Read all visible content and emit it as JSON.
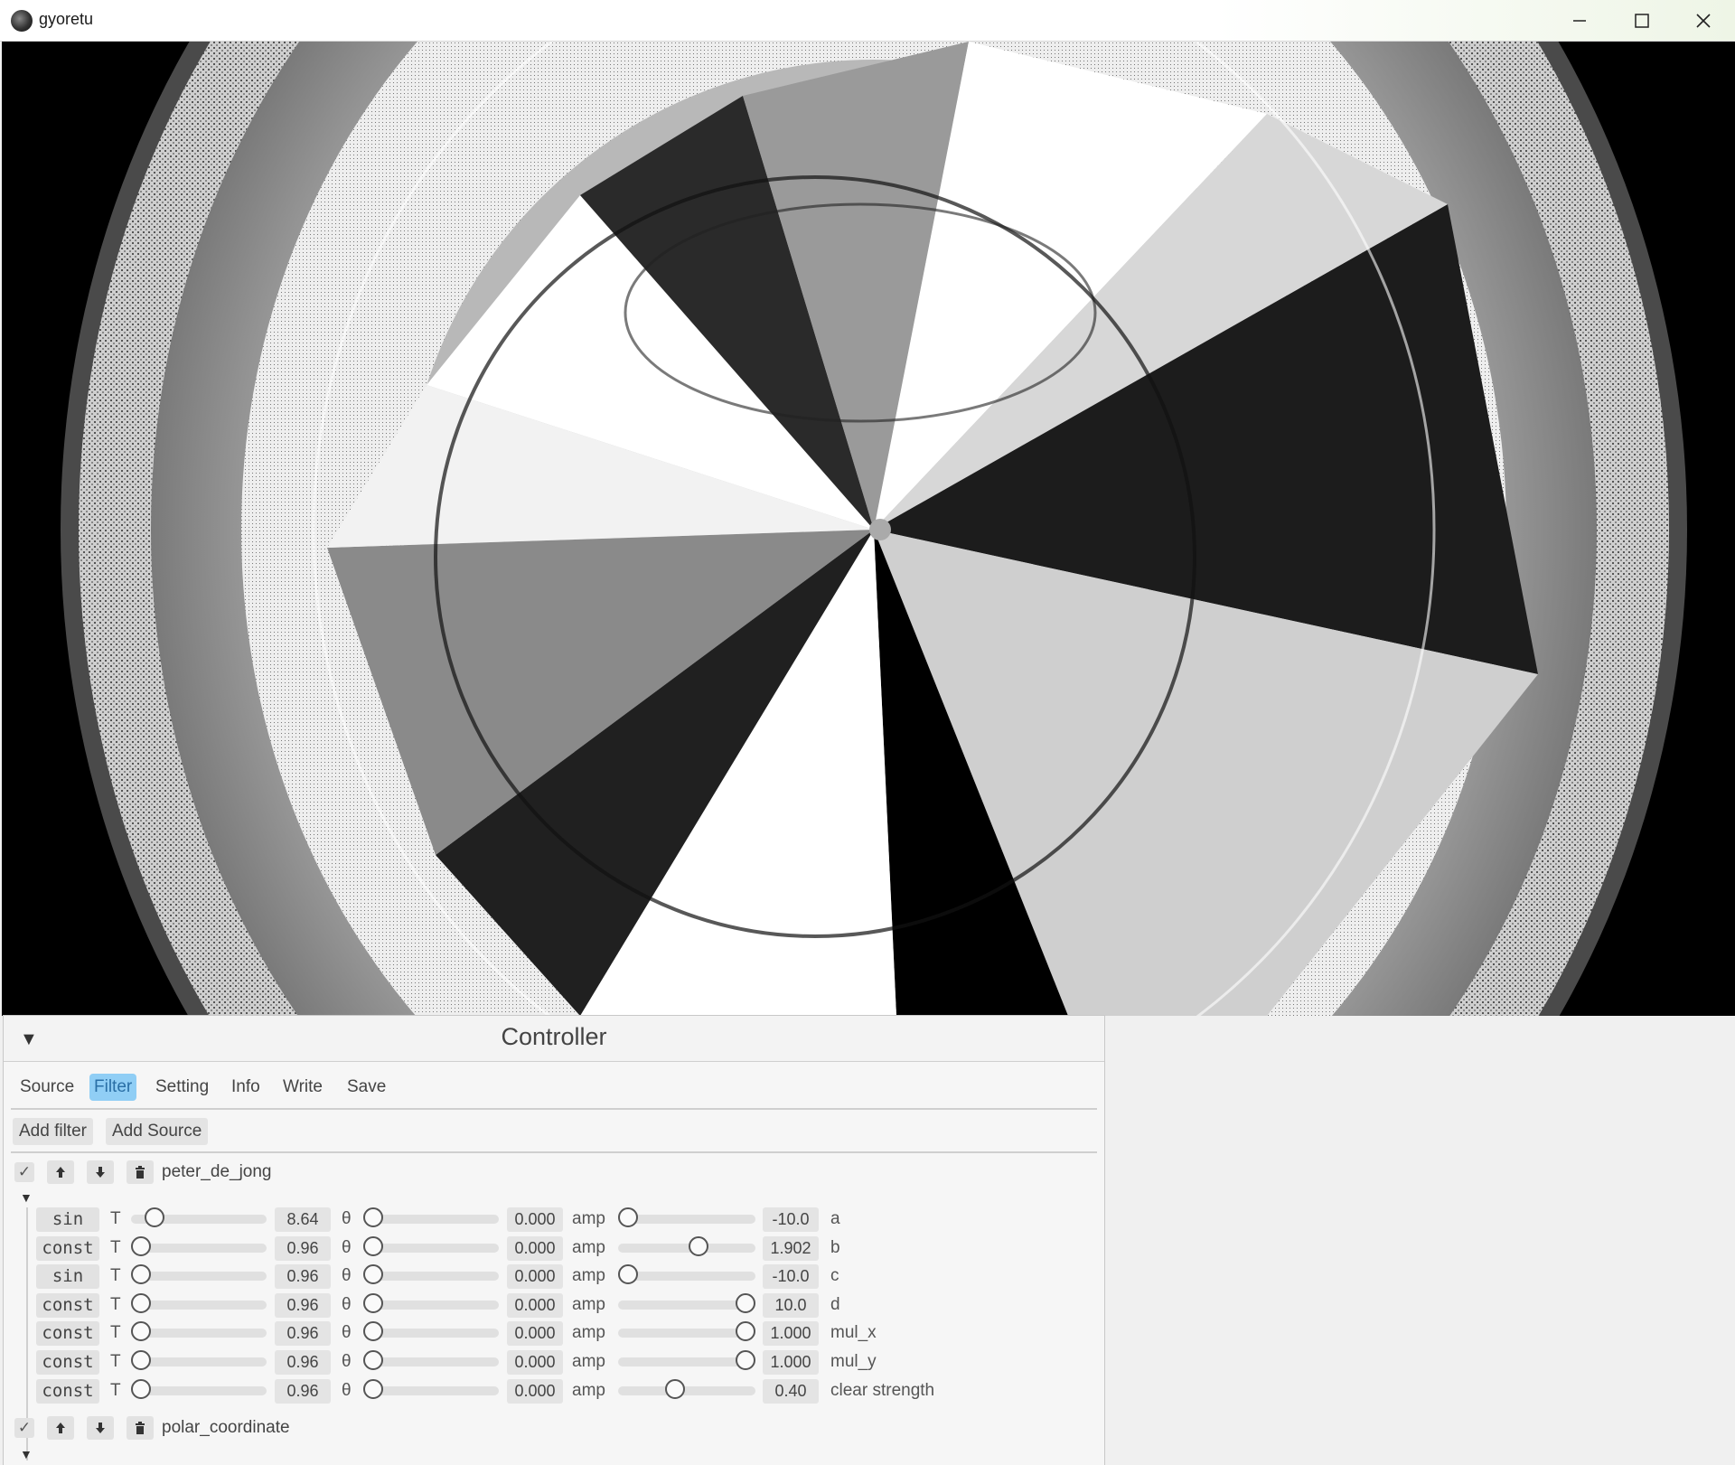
{
  "window": {
    "title": "gyoretu",
    "controls": [
      "minimize-icon",
      "maximize-icon",
      "close-icon"
    ]
  },
  "canvas": {
    "description_icon": "fractal-render",
    "background": "#000000"
  },
  "controller": {
    "title": "Controller",
    "collapse_glyph": "▼",
    "tabs": [
      {
        "label": "Source",
        "active": false
      },
      {
        "label": "Filter",
        "active": true
      },
      {
        "label": "Setting",
        "active": false
      },
      {
        "label": "Info",
        "active": false
      },
      {
        "label": "Write",
        "active": false
      },
      {
        "label": "Save",
        "active": false
      }
    ],
    "buttons": {
      "add_filter": "Add filter",
      "add_source": "Add Source"
    },
    "filters": [
      {
        "name": "peter_de_jong",
        "enabled": true,
        "expanded": true,
        "params": [
          {
            "mode": "sin",
            "t_value": "8.64",
            "t_pos": 0.12,
            "theta_value": "0.000",
            "theta_pos": 0.0,
            "amp_value": "-10.0",
            "amp_pos": 0.0,
            "name": "a"
          },
          {
            "mode": "const",
            "t_value": "0.96",
            "t_pos": 0.0,
            "theta_value": "0.000",
            "theta_pos": 0.0,
            "amp_value": "1.902",
            "amp_pos": 0.6,
            "name": "b"
          },
          {
            "mode": "sin",
            "t_value": "0.96",
            "t_pos": 0.0,
            "theta_value": "0.000",
            "theta_pos": 0.0,
            "amp_value": "-10.0",
            "amp_pos": 0.0,
            "name": "c"
          },
          {
            "mode": "const",
            "t_value": "0.96",
            "t_pos": 0.0,
            "theta_value": "0.000",
            "theta_pos": 0.0,
            "amp_value": "10.0",
            "amp_pos": 1.0,
            "name": "d"
          },
          {
            "mode": "const",
            "t_value": "0.96",
            "t_pos": 0.0,
            "theta_value": "0.000",
            "theta_pos": 0.0,
            "amp_value": "1.000",
            "amp_pos": 1.0,
            "name": "mul_x"
          },
          {
            "mode": "const",
            "t_value": "0.96",
            "t_pos": 0.0,
            "theta_value": "0.000",
            "theta_pos": 0.0,
            "amp_value": "1.000",
            "amp_pos": 1.0,
            "name": "mul_y"
          },
          {
            "mode": "const",
            "t_value": "0.96",
            "t_pos": 0.0,
            "theta_value": "0.000",
            "theta_pos": 0.0,
            "amp_value": "0.40",
            "amp_pos": 0.4,
            "name": "clear strength"
          }
        ]
      },
      {
        "name": "polar_coordinate",
        "enabled": true,
        "expanded": true,
        "params": []
      }
    ],
    "labels": {
      "t": "T",
      "theta": "θ",
      "amp": "amp",
      "check": "✓",
      "expand": "▼"
    }
  }
}
